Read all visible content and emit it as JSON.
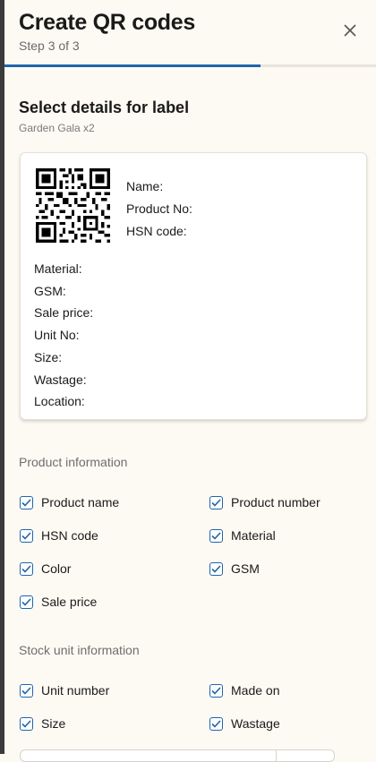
{
  "header": {
    "title": "Create QR codes",
    "step": "Step 3 of 3",
    "progress_fraction": 0.69
  },
  "section": {
    "title": "Select details for label",
    "subtitle": "Garden Gala x2"
  },
  "label_preview": {
    "qr_fields": [
      "Name:",
      "Product No:",
      "HSN code:"
    ],
    "details": [
      "Material:",
      "GSM:",
      "Sale price:",
      "Unit No:",
      "Size:",
      "Wastage:",
      "Location:"
    ]
  },
  "product_info": {
    "title": "Product information",
    "options": [
      {
        "label": "Product name",
        "checked": true
      },
      {
        "label": "Product number",
        "checked": true
      },
      {
        "label": "HSN code",
        "checked": true
      },
      {
        "label": "Material",
        "checked": true
      },
      {
        "label": "Color",
        "checked": true
      },
      {
        "label": "GSM",
        "checked": true
      },
      {
        "label": "Sale price",
        "checked": true
      }
    ]
  },
  "stock_info": {
    "title": "Stock unit information",
    "options": [
      {
        "label": "Unit number",
        "checked": true
      },
      {
        "label": "Made on",
        "checked": true
      },
      {
        "label": "Size",
        "checked": true
      },
      {
        "label": "Wastage",
        "checked": true
      }
    ]
  },
  "icons": {
    "close": "close-icon",
    "checkbox": "checkbox-checked-icon",
    "qr": "qr-code-image"
  },
  "colors": {
    "accent": "#1f65ad",
    "background": "#fdfaf3"
  }
}
